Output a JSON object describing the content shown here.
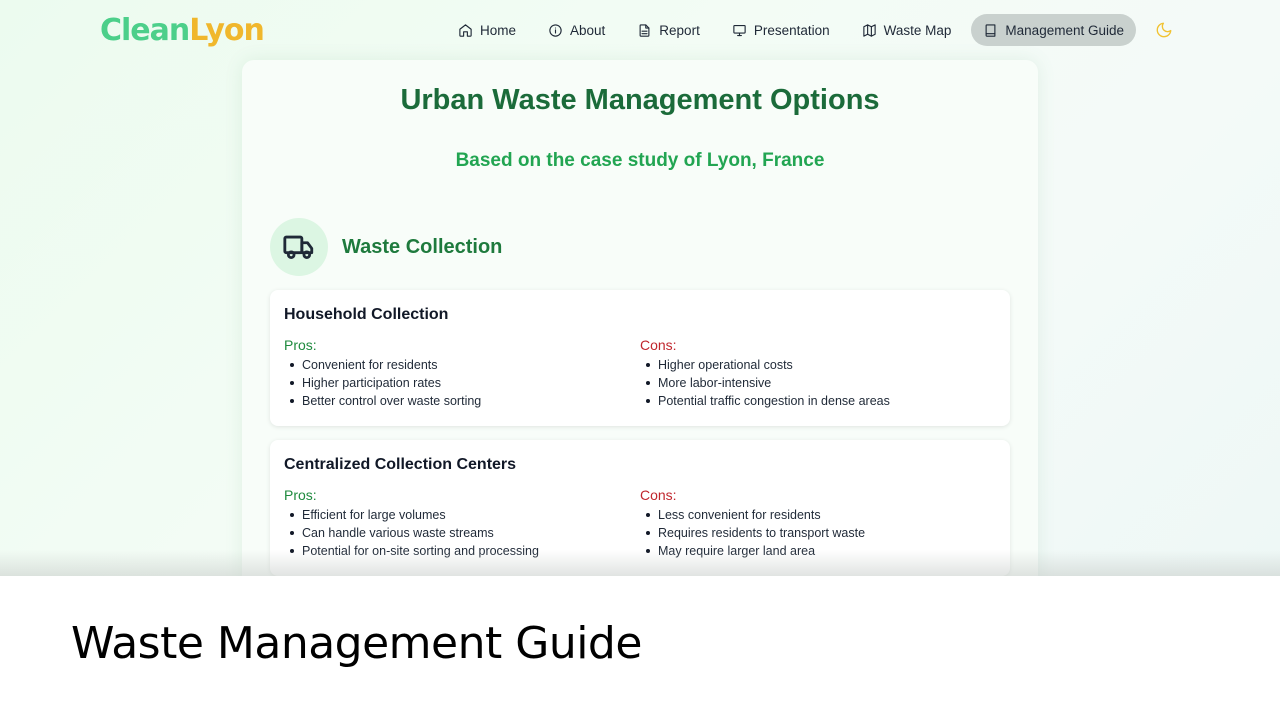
{
  "brand": {
    "clean": "Clean",
    "lyon": "Lyon"
  },
  "nav": {
    "items": [
      {
        "label": "Home",
        "icon": "home-icon"
      },
      {
        "label": "About",
        "icon": "info-icon"
      },
      {
        "label": "Report",
        "icon": "document-icon"
      },
      {
        "label": "Presentation",
        "icon": "presentation-icon"
      },
      {
        "label": "Waste Map",
        "icon": "map-icon"
      },
      {
        "label": "Management Guide",
        "icon": "book-icon",
        "active": true
      }
    ],
    "theme_icon": "moon-icon"
  },
  "page": {
    "title": "Urban Waste Management Options",
    "subtitle": "Based on the case study of Lyon, France"
  },
  "section": {
    "title": "Waste Collection",
    "icon": "truck-icon",
    "cards": [
      {
        "title": "Household Collection",
        "pros_label": "Pros:",
        "cons_label": "Cons:",
        "pros": [
          "Convenient for residents",
          "Higher participation rates",
          "Better control over waste sorting"
        ],
        "cons": [
          "Higher operational costs",
          "More labor-intensive",
          "Potential traffic congestion in dense areas"
        ]
      },
      {
        "title": "Centralized Collection Centers",
        "pros_label": "Pros:",
        "cons_label": "Cons:",
        "pros": [
          "Efficient for large volumes",
          "Can handle various waste streams",
          "Potential for on-site sorting and processing"
        ],
        "cons": [
          "Less convenient for residents",
          "Requires residents to transport waste",
          "May require larger land area"
        ]
      }
    ]
  },
  "caption": "Waste Management Guide",
  "colors": {
    "accent": "#1b6b3a",
    "subtitle": "#22a552",
    "pros": "#1e8a3e",
    "cons": "#c0262d",
    "logo_green": "#4ccf8a",
    "logo_yellow": "#f0b72c"
  }
}
